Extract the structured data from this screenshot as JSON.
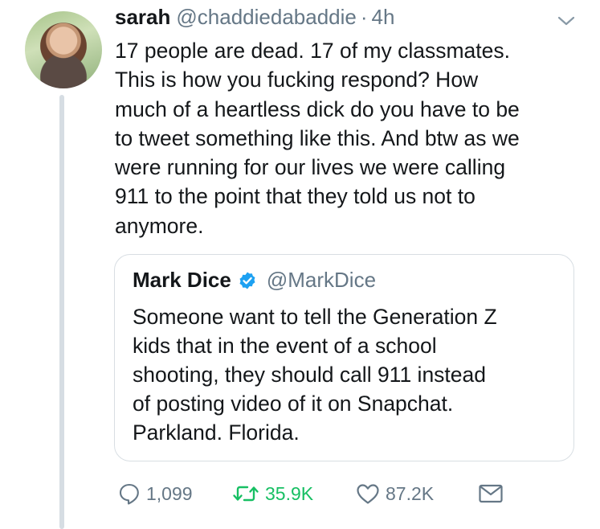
{
  "tweet": {
    "author_name": "sarah",
    "author_handle": "@chaddiedabaddie",
    "separator": "·",
    "time": "4h",
    "lines": [
      "17 people are dead. 17 of my classmates.",
      "This is how you fucking respond? How",
      "much of a heartless dick do you have to be",
      "to tweet something like this. And btw as we",
      "were running for our lives we were calling",
      "911 to the point that they told us not to",
      "anymore."
    ]
  },
  "quoted_tweet": {
    "author_name": "Mark Dice",
    "author_handle": "@MarkDice",
    "lines": [
      "Someone want to tell the Generation Z",
      "kids that in the event of a school",
      "shooting, they should call 911 instead",
      "of posting video of it on Snapchat.",
      "Parkland.  Florida."
    ]
  },
  "actions": {
    "reply_count": "1,099",
    "retweet_count": "35.9K",
    "like_count": "87.2K"
  },
  "icons": {
    "avatar": "profile-photo",
    "caret": "chevron-down-icon",
    "verified": "verified-badge-icon",
    "reply": "reply-icon",
    "retweet": "retweet-icon",
    "like": "heart-icon",
    "message": "envelope-icon"
  },
  "colors": {
    "text": "#14171a",
    "secondary": "#657786",
    "retweet": "#17bf63",
    "verified": "#1da1f2",
    "border": "#d8dee3"
  }
}
